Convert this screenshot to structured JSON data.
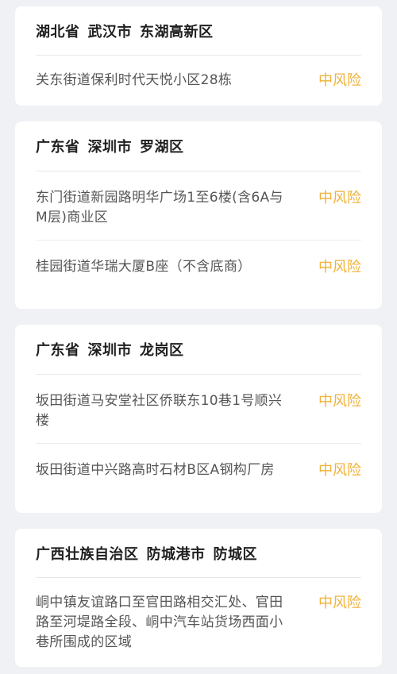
{
  "colors": {
    "background": "#f0f1f5",
    "card": "#ffffff",
    "risk_medium": "#f0b23a",
    "header_text": "#1f1f1f",
    "address_text": "#555555"
  },
  "regions": [
    {
      "province": "湖北省",
      "city": "武汉市",
      "district": "东湖高新区",
      "items": [
        {
          "address": "关东街道保利时代天悦小区28栋",
          "risk": "中风险"
        }
      ]
    },
    {
      "province": "广东省",
      "city": "深圳市",
      "district": "罗湖区",
      "items": [
        {
          "address": "东门街道新园路明华广场1至6楼(含6A与M层)商业区",
          "risk": "中风险"
        },
        {
          "address": "桂园街道华瑞大厦B座（不含底商）",
          "risk": "中风险"
        }
      ]
    },
    {
      "province": "广东省",
      "city": "深圳市",
      "district": "龙岗区",
      "items": [
        {
          "address": "坂田街道马安堂社区侨联东10巷1号顺兴楼",
          "risk": "中风险"
        },
        {
          "address": "坂田街道中兴路高时石材B区A钢构厂房",
          "risk": "中风险"
        }
      ]
    },
    {
      "province": "广西壮族自治区",
      "city": "防城港市",
      "district": "防城区",
      "items": [
        {
          "address": "峒中镇友谊路口至官田路相交汇处、官田路至河堤路全段、峒中汽车站货场西面小巷所围成的区域",
          "risk": "中风险"
        }
      ]
    }
  ]
}
